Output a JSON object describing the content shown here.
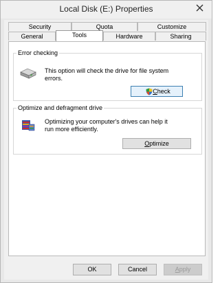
{
  "window": {
    "title": "Local Disk (E:) Properties"
  },
  "tabs": {
    "row1": [
      "Security",
      "Quota",
      "Customize"
    ],
    "row2": [
      "General",
      "Tools",
      "Hardware",
      "Sharing"
    ],
    "selected": "Tools"
  },
  "error_checking": {
    "title": "Error checking",
    "description": "This option will check the drive for file system errors.",
    "button": "Check",
    "button_mnemonic": "C",
    "button_rest": "heck",
    "icon": "drive-icon",
    "shield_icon": "uac-shield-icon"
  },
  "optimize": {
    "title": "Optimize and defragment drive",
    "description": "Optimizing your computer's drives can help it run more efficiently.",
    "button": "Optimize",
    "button_mnemonic": "O",
    "button_rest": "ptimize",
    "icon": "defrag-icon"
  },
  "footer": {
    "ok": "OK",
    "cancel": "Cancel",
    "apply": "Apply",
    "apply_mnemonic": "A",
    "apply_rest": "pply"
  }
}
